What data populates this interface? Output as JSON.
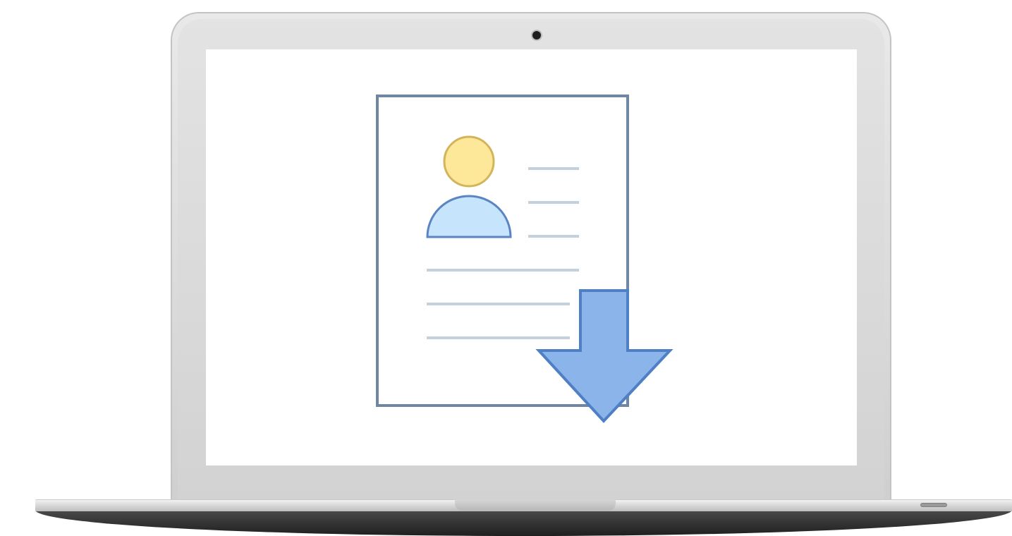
{
  "device": {
    "type": "laptop",
    "screen_background": "#ffffff"
  },
  "screen_content": {
    "icon": "resume-download-icon",
    "colors": {
      "document_border": "#6f87a3",
      "document_fill": "#ffffff",
      "text_lines": "#c3d1dd",
      "avatar_head_fill": "#fde89a",
      "avatar_head_stroke": "#d4b45a",
      "avatar_body_fill": "#c6e4fb",
      "avatar_body_stroke": "#5b85c2",
      "arrow_fill": "#8ab4ea",
      "arrow_stroke": "#4f7fc4"
    }
  }
}
